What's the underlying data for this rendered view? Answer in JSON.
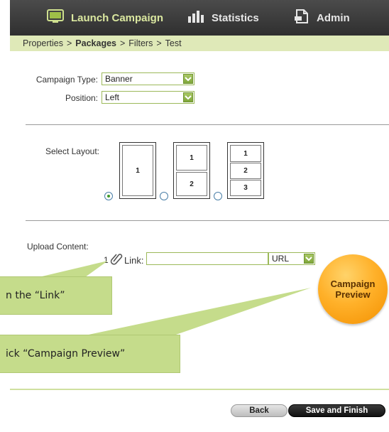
{
  "nav": {
    "launch": "Launch Campaign",
    "statistics": "Statistics",
    "admin": "Admin"
  },
  "breadcrumb": {
    "properties": "Properties",
    "packages": "Packages",
    "filters": "Filters",
    "test": "Test",
    "sep": ">"
  },
  "form": {
    "campaign_type_label": "Campaign Type:",
    "campaign_type_value": "Banner",
    "position_label": "Position:",
    "position_value": "Left",
    "select_layout_label": "Select Layout:",
    "upload_content_label": "Upload Content:",
    "upload_index": "1",
    "link_label": "Link:",
    "link_value": "",
    "link_type_value": "URL"
  },
  "layouts": {
    "one": [
      "1"
    ],
    "two": [
      "1",
      "2"
    ],
    "three": [
      "1",
      "2",
      "3"
    ]
  },
  "tips": {
    "tip1": "n the “Link”",
    "tip2": "ick “Campaign Preview”"
  },
  "preview": {
    "line1": "Campaign",
    "line2": "Preview"
  },
  "buttons": {
    "back": "Back",
    "finish": "Save and Finish"
  },
  "colors": {
    "accent_green": "#c5dc8b",
    "nav_bg": "#3a3a3a",
    "preview_orange": "#ffb12a"
  }
}
